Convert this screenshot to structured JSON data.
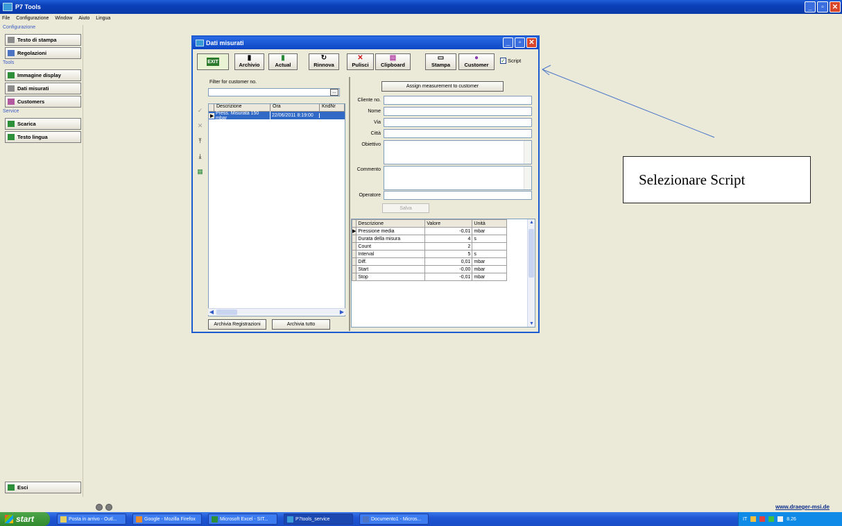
{
  "app": {
    "title": "P7 Tools",
    "menu": [
      "File",
      "Configurazione",
      "Window",
      "Aiuto",
      "Lingua"
    ],
    "window_buttons": [
      "_",
      "▫",
      "✕"
    ]
  },
  "left_panel": {
    "group_config": "Configurazione",
    "btn_testo_stampa": "Testo di stampa",
    "btn_regolazioni": "Regolazioni",
    "group_tools": "Tools",
    "btn_immagine_display": "Immagine display",
    "btn_dati_misurati": "Dati misurati",
    "btn_customers": "Customers",
    "group_service": "Service",
    "btn_scarica": "Scarica",
    "btn_testo_lingua": "Testo lingua",
    "btn_esci": "Esci"
  },
  "child_window": {
    "title": "Dati misurati",
    "toolbar": {
      "exit": "EXIT",
      "archivio": "Archivio",
      "actual": "Actual",
      "rinnova": "Rinnova",
      "pulisci": "Pulisci",
      "clipboard": "Clipboard",
      "stampa": "Stampa",
      "customer": "Customer",
      "script": "Script",
      "script_checked": true
    },
    "filter": {
      "label": "Filter for customer no.",
      "value": "",
      "button": "..."
    },
    "list": {
      "headers": [
        "Descrizione",
        "Ora",
        "KndNr"
      ],
      "rows": [
        [
          "Press. Misurata 150 mbar",
          "22/06/2011 8:19:00",
          ""
        ]
      ]
    },
    "btn_archivia_registrazioni": "Archivia Registrazioni",
    "btn_archivia_tutto": "Archivia tutto",
    "btn_assign": "Assign measurement to customer",
    "fields": {
      "cliente_no": "Cliente no.",
      "nome": "Nome",
      "via": "Via",
      "citta": "Città",
      "obiettivo": "Obiettivo",
      "commento": "Commento",
      "operatore": "Operatore"
    },
    "btn_salva": "Salva",
    "grid": {
      "headers": [
        "Descrizione",
        "Valore",
        "Unità"
      ],
      "rows": [
        [
          "Pressione media",
          "-0,01",
          "mbar"
        ],
        [
          "Durata della misura",
          "4",
          "s"
        ],
        [
          "Count",
          "2",
          ""
        ],
        [
          "Interval",
          "5",
          "s"
        ],
        [
          "Diff.",
          "0,01",
          "mbar"
        ],
        [
          "Start",
          "-0,00",
          "mbar"
        ],
        [
          "Stop",
          "-0,01",
          "mbar"
        ]
      ]
    }
  },
  "callout": {
    "text": "Selezionare Script"
  },
  "footer": {
    "website": "www.draeger-msi.de"
  },
  "taskbar": {
    "start": "start",
    "tasks": [
      "Posta in arrivo - Outl...",
      "Google - Mozilla Firefox",
      "Microsoft Excel - SIT...",
      "P7tools_service",
      "Documento1 - Micros..."
    ],
    "tray_lang": "IT",
    "clock": "8.26"
  }
}
